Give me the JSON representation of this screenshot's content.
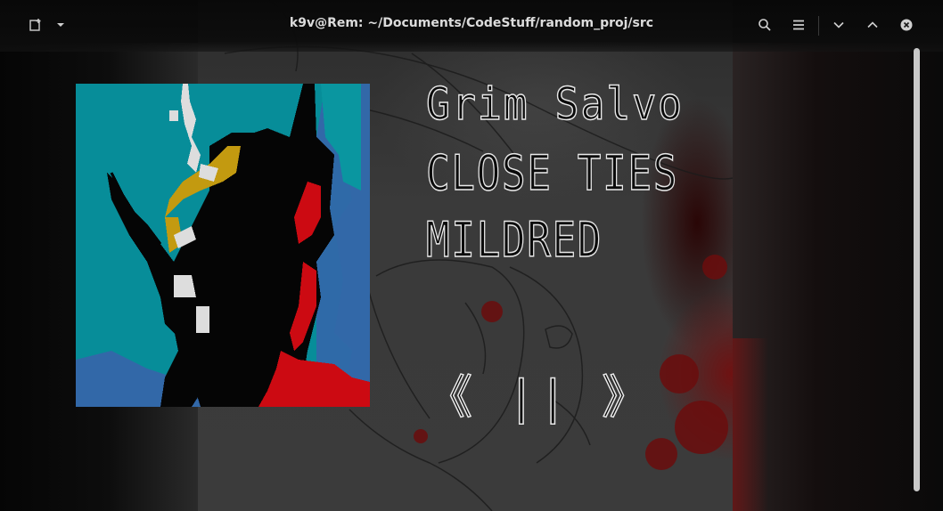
{
  "window": {
    "title": "k9v@Rem: ~/Documents/CodeStuff/random_proj/src"
  },
  "header": {
    "new_tab_icon": "new-tab-icon",
    "menu_arrow_icon": "chevron-down-icon",
    "search_icon": "search-icon",
    "hamburger_icon": "hamburger-menu-icon",
    "minimize_icon": "chevron-down-icon",
    "maximize_icon": "chevron-up-icon",
    "close_icon": "close-icon"
  },
  "player": {
    "artist": "Grim Salvo",
    "album": "CLOSE TIES",
    "track": "MILDRED",
    "controls": "《 || 》"
  },
  "colors": {
    "text_outline": "#e8e8e8",
    "album_teal": "#078d99",
    "album_blue": "#3268a8",
    "album_red": "#cc0a12",
    "album_gold": "#c39a10"
  }
}
